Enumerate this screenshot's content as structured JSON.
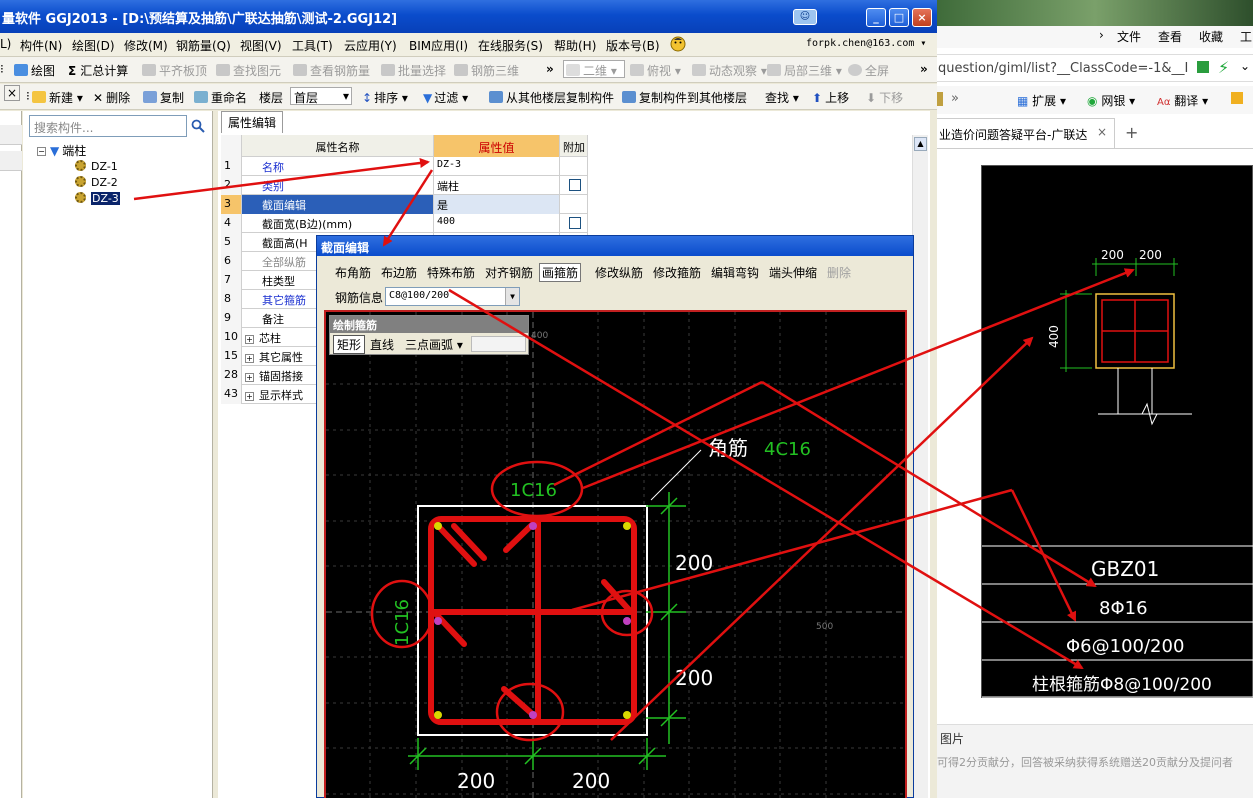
{
  "window": {
    "title": "量软件 GGJ2013 - [D:\\预结算及抽筋\\广联达抽筋\\测试-2.GGJ12]",
    "minimize": "_",
    "maximize": "□",
    "close": "×"
  },
  "menu": {
    "items": [
      "L)",
      "构件(N)",
      "绘图(D)",
      "修改(M)",
      "钢筋量(Q)",
      "视图(V)",
      "工具(T)",
      "云应用(Y)",
      "BIM应用(I)",
      "在线服务(S)",
      "帮助(H)",
      "版本号(B)"
    ],
    "account": "forpk.chen@163.com ▾"
  },
  "toolbar1": {
    "items": [
      "绘图",
      "汇总计算",
      "平齐板顶",
      "查找图元",
      "查看钢筋量",
      "批量选择",
      "钢筋三维",
      "»",
      "二维",
      "俯视",
      "动态观察",
      "局部三维",
      "全屏",
      "»"
    ]
  },
  "toolbar2": {
    "items": [
      "新建",
      "删除",
      "复制",
      "重命名",
      "楼层",
      "首层",
      "排序",
      "过滤",
      "从其他楼层复制构件",
      "复制构件到其他楼层",
      "查找",
      "上移",
      "下移"
    ]
  },
  "left_panel": {
    "search_placeholder": "搜索构件...",
    "root": "端柱",
    "children": [
      "DZ-1",
      "DZ-2",
      "DZ-3"
    ]
  },
  "properties": {
    "tab": "属性编辑",
    "headers": [
      "属性名称",
      "属性值",
      "附加"
    ],
    "rows": [
      {
        "num": "1",
        "name": "名称",
        "value": "DZ-3",
        "check": false
      },
      {
        "num": "2",
        "name": "类别",
        "value": "端柱",
        "check": true
      },
      {
        "num": "3",
        "name": "截面编辑",
        "value": "是",
        "check": false
      },
      {
        "num": "4",
        "name": "截面宽(B边)(mm)",
        "value": "400",
        "check": true
      },
      {
        "num": "5",
        "name": "截面高(H",
        "value": "",
        "check": false
      },
      {
        "num": "6",
        "name": "全部纵筋",
        "value": "",
        "check": false
      },
      {
        "num": "7",
        "name": "柱类型",
        "value": "",
        "check": false
      },
      {
        "num": "8",
        "name": "其它箍筋",
        "value": "",
        "check": false
      },
      {
        "num": "9",
        "name": "备注",
        "value": "",
        "check": false
      },
      {
        "num": "10",
        "name": "芯柱",
        "value": "",
        "check": false
      },
      {
        "num": "15",
        "name": "其它属性",
        "value": "",
        "check": false
      },
      {
        "num": "28",
        "name": "锚固搭接",
        "value": "",
        "check": false
      },
      {
        "num": "43",
        "name": "显示样式",
        "value": "",
        "check": false
      }
    ]
  },
  "dialog": {
    "title": "截面编辑",
    "tools": [
      "布角筋",
      "布边筋",
      "特殊布筋",
      "对齐钢筋",
      "画箍筋",
      "修改纵筋",
      "修改箍筋",
      "编辑弯钩",
      "端头伸缩",
      "删除"
    ],
    "rebar_info_label": "钢筋信息",
    "rebar_info_value": "C8@100/200",
    "draw_panel": {
      "title": "绘制箍筋",
      "items": [
        "矩形",
        "直线",
        "三点画弧"
      ]
    },
    "canvas": {
      "tick_top": "400",
      "tick_right": "500",
      "corner_label": "角筋",
      "corner_value": "4C16",
      "top_side": "1C16",
      "left_side": "1C16",
      "dim_right_1": "200",
      "dim_right_2": "200",
      "dim_bottom_1": "200",
      "dim_bottom_2": "200"
    }
  },
  "browser": {
    "menu": [
      "›",
      "文件",
      "查看",
      "收藏",
      "工"
    ],
    "address": "question/giml/list?__ClassCode=-1&__I",
    "fav": [
      "»",
      "扩展",
      "网银",
      "翻译"
    ],
    "tab": "业造价问题答疑平台-广联达",
    "tab_close": "×",
    "new_tab": "+",
    "drawing": {
      "dim_top_1": "200",
      "dim_top_2": "200",
      "dim_left": "400",
      "table": [
        "GBZ01",
        "8Φ16",
        "Φ6@100/200",
        "柱根箍筋Φ8@100/200"
      ]
    },
    "footer_title": "图片",
    "footer_text": "可得2分贡献分，回答被采纳获得系统赠送20贡献分及提问者"
  },
  "colors": {
    "titlebar": "#0a4ccc",
    "rebar": "#e01010",
    "dimension": "#22c022",
    "annotation_arrow": "#e01010",
    "highlight_row": "#2b5fb8"
  }
}
